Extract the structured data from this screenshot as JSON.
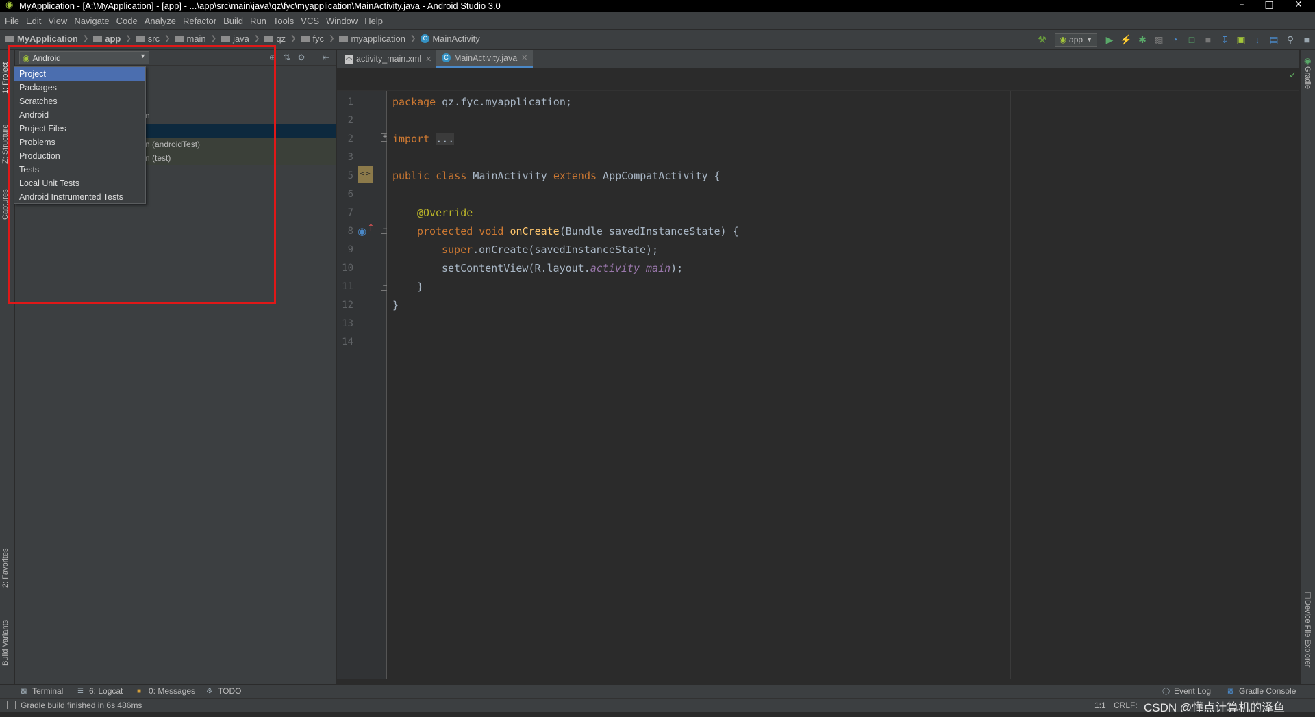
{
  "window": {
    "title": "MyApplication - [A:\\MyApplication] - [app] - ...\\app\\src\\main\\java\\qz\\fyc\\myapplication\\MainActivity.java - Android Studio 3.0"
  },
  "menu": [
    "File",
    "Edit",
    "View",
    "Navigate",
    "Code",
    "Analyze",
    "Refactor",
    "Build",
    "Run",
    "Tools",
    "VCS",
    "Window",
    "Help"
  ],
  "breadcrumbs": [
    "MyApplication",
    "app",
    "src",
    "main",
    "java",
    "qz",
    "fyc",
    "myapplication",
    "MainActivity"
  ],
  "toolbar": {
    "run_config": "app"
  },
  "left_stripe": {
    "project": "1: Project",
    "structure": "Z: Structure",
    "captures": "Captures",
    "favorites": "2: Favorites",
    "build_variants": "Build Variants"
  },
  "right_stripe": {
    "gradle": "Gradle",
    "device_file_explorer": "Device File Explorer"
  },
  "project_panel": {
    "view_combo": "Android",
    "tree_fragments": [
      "n",
      "n (androidTest)",
      "n (test)"
    ]
  },
  "view_dropdown": {
    "items": [
      "Project",
      "Packages",
      "Scratches",
      "Android",
      "Project Files",
      "Problems",
      "Production",
      "Tests",
      "Local Unit Tests",
      "Android Instrumented Tests"
    ],
    "selected_index": 0
  },
  "editor_tabs": [
    {
      "label": "activity_main.xml",
      "active": false
    },
    {
      "label": "MainActivity.java",
      "active": true
    }
  ],
  "code": {
    "line_numbers": [
      "1",
      "2",
      "3",
      "5",
      "6",
      "7",
      "8",
      "9",
      "10",
      "11",
      "12",
      "13",
      "14"
    ],
    "l1_kw": "package",
    "l1_rest": " qz.fyc.myapplication;",
    "l3_kw": "import",
    "l3_fold": "...",
    "l6_kw1": "public class",
    "l6_name": " MainActivity ",
    "l6_kw2": "extends",
    "l6_rest": " AppCompatActivity {",
    "l8_ann": "@Override",
    "l9_kw": "protected void",
    "l9_fn": " onCreate",
    "l9_rest": "(Bundle savedInstanceState) {",
    "l10_kw": "super",
    "l10_rest": ".onCreate(savedInstanceState);",
    "l11_pre": "setContentView(R.layout.",
    "l11_fld": "activity_main",
    "l11_post": ");",
    "l12": "}",
    "l13": "}"
  },
  "bottom_tools": [
    "Terminal",
    "6: Logcat",
    "0: Messages",
    "TODO"
  ],
  "bottom_right_tools": [
    "Event Log",
    "Gradle Console"
  ],
  "status": {
    "message": "Gradle build finished in 6s 486ms",
    "position": "1:1",
    "line_sep": "CRLF:",
    "watermark": "CSDN @懂点计算机的泽鱼"
  }
}
